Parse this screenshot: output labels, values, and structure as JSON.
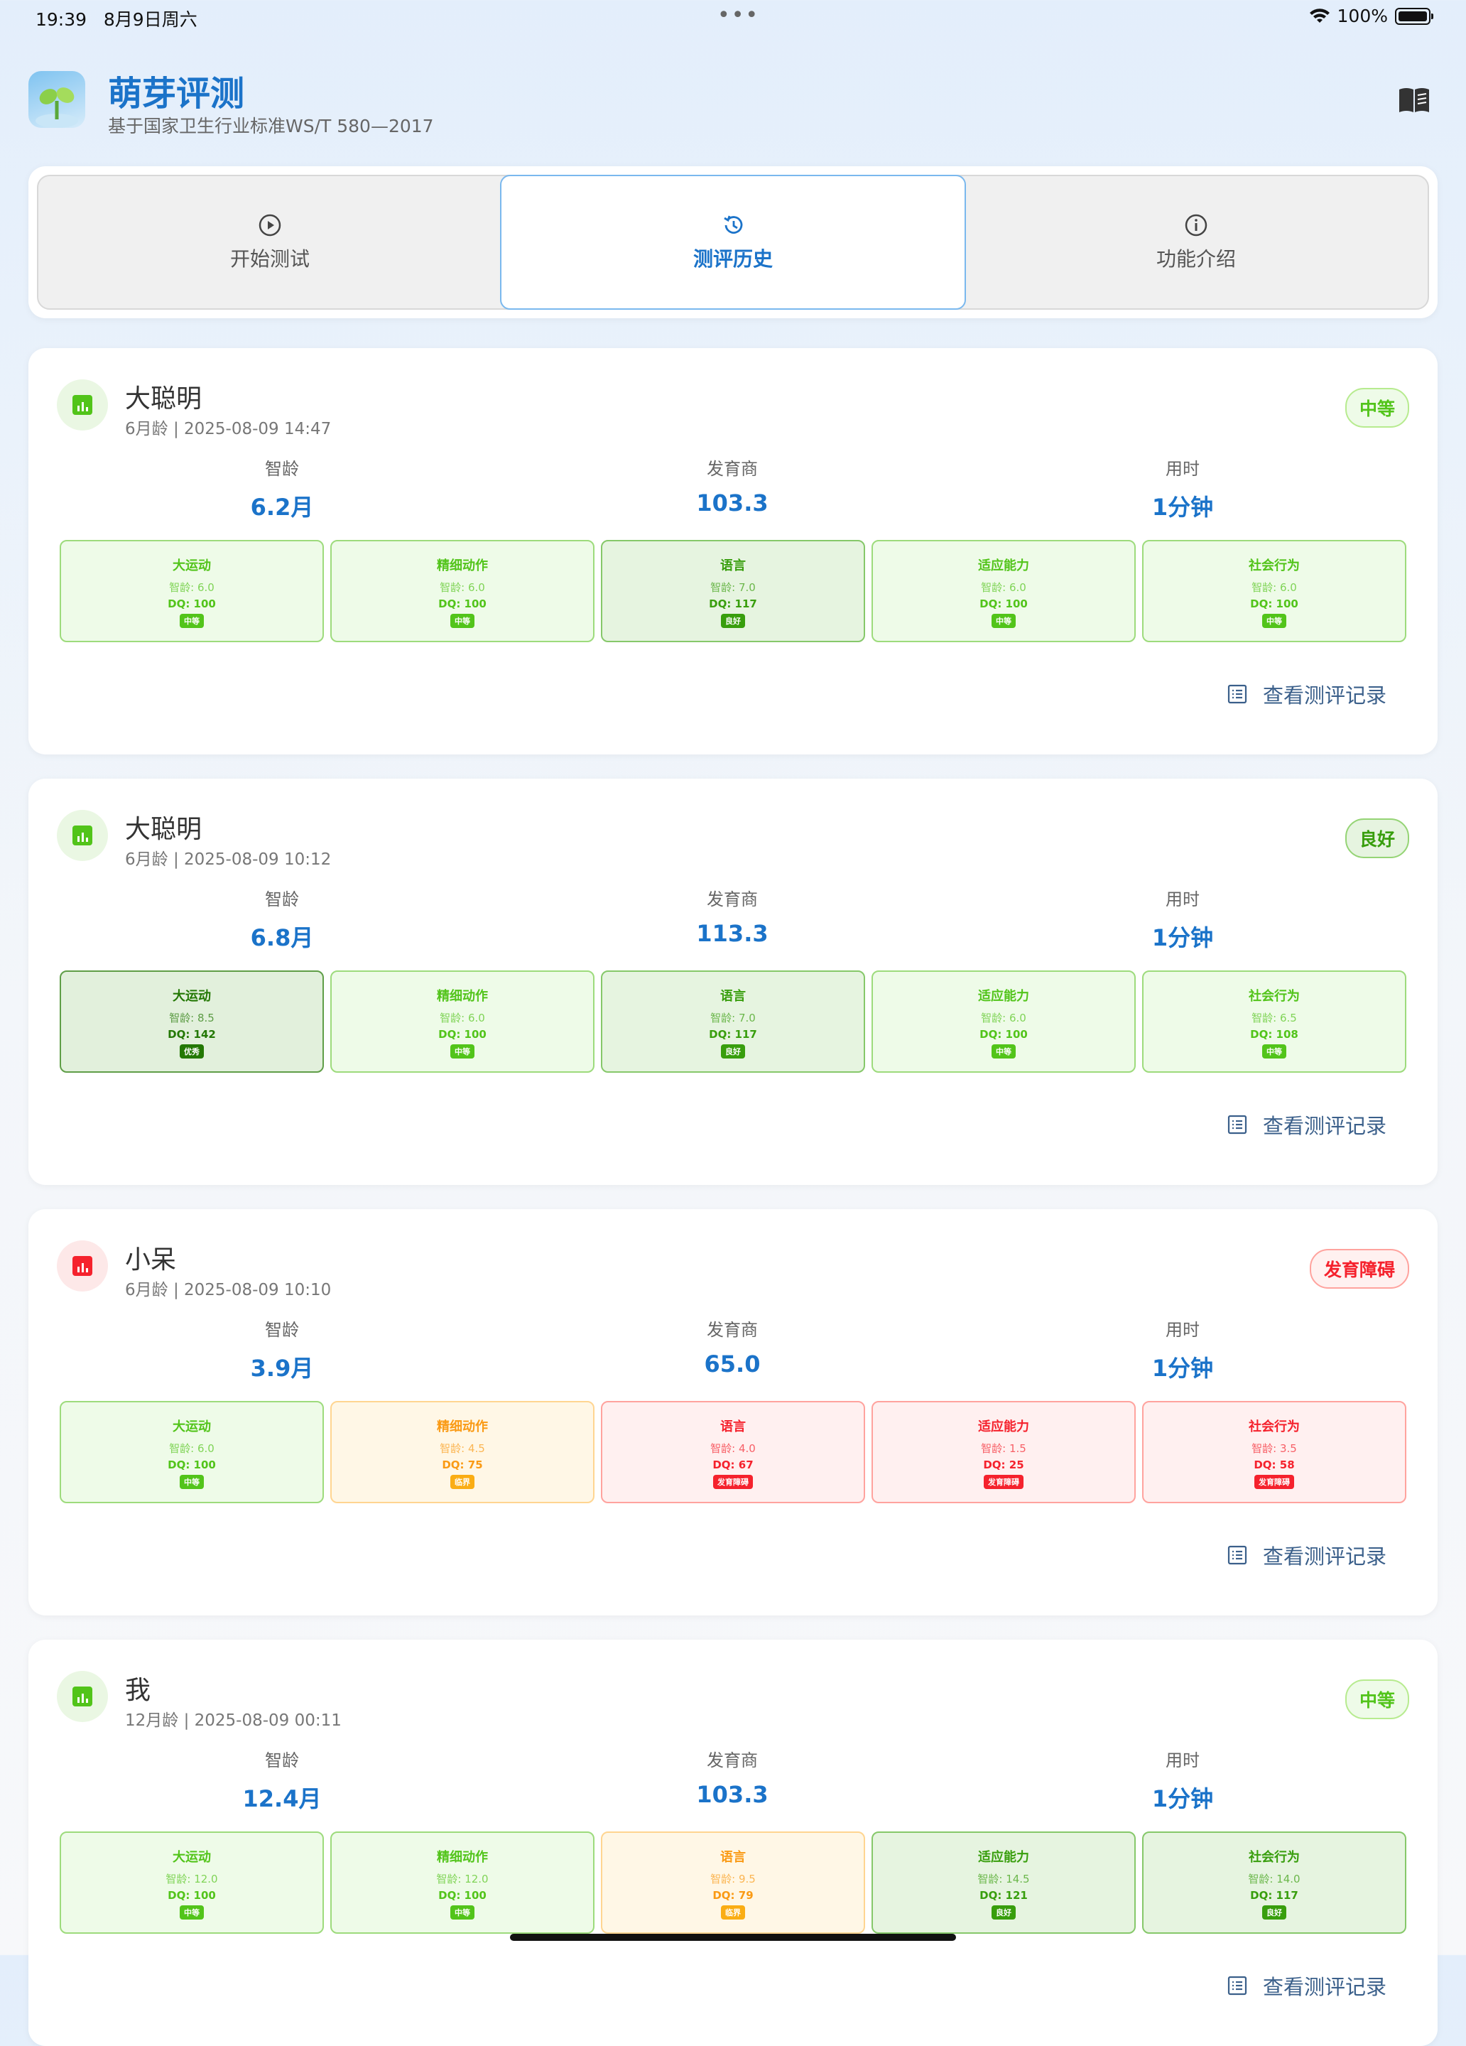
{
  "status_bar": {
    "time": "19:39",
    "date": "8月9日周六",
    "battery": "100%"
  },
  "app": {
    "title": "萌芽评测",
    "subtitle": "基于国家卫生行业标准WS/T 580—2017"
  },
  "tabs": [
    {
      "label": "开始测试",
      "icon": "play-circle-icon"
    },
    {
      "label": "测评历史",
      "icon": "history-icon"
    },
    {
      "label": "功能介绍",
      "icon": "info-icon"
    }
  ],
  "stat_labels": {
    "mental_age": "智龄",
    "dq": "发育商",
    "duration": "用时"
  },
  "view_record_label": "查看测评记录",
  "colors": {
    "中等": "#52c41a",
    "良好": "#389e0d",
    "优秀": "#237804",
    "临界": "#faad14",
    "发育障碍": "#f5222d"
  },
  "records": [
    {
      "name": "大聪明",
      "meta": "6月龄 | 2025-08-09 14:47",
      "level": "中等",
      "mental_age": "6.2月",
      "dq": "103.3",
      "duration": "1分钟",
      "domains": [
        {
          "name": "大运动",
          "age": "智龄: 6.0",
          "dq": "DQ: 100",
          "tag": "中等"
        },
        {
          "name": "精细动作",
          "age": "智龄: 6.0",
          "dq": "DQ: 100",
          "tag": "中等"
        },
        {
          "name": "语言",
          "age": "智龄: 7.0",
          "dq": "DQ: 117",
          "tag": "良好"
        },
        {
          "name": "适应能力",
          "age": "智龄: 6.0",
          "dq": "DQ: 100",
          "tag": "中等"
        },
        {
          "name": "社会行为",
          "age": "智龄: 6.0",
          "dq": "DQ: 100",
          "tag": "中等"
        }
      ]
    },
    {
      "name": "大聪明",
      "meta": "6月龄 | 2025-08-09 10:12",
      "level": "良好",
      "mental_age": "6.8月",
      "dq": "113.3",
      "duration": "1分钟",
      "domains": [
        {
          "name": "大运动",
          "age": "智龄: 8.5",
          "dq": "DQ: 142",
          "tag": "优秀"
        },
        {
          "name": "精细动作",
          "age": "智龄: 6.0",
          "dq": "DQ: 100",
          "tag": "中等"
        },
        {
          "name": "语言",
          "age": "智龄: 7.0",
          "dq": "DQ: 117",
          "tag": "良好"
        },
        {
          "name": "适应能力",
          "age": "智龄: 6.0",
          "dq": "DQ: 100",
          "tag": "中等"
        },
        {
          "name": "社会行为",
          "age": "智龄: 6.5",
          "dq": "DQ: 108",
          "tag": "中等"
        }
      ]
    },
    {
      "name": "小呆",
      "meta": "6月龄 | 2025-08-09 10:10",
      "level": "发育障碍",
      "mental_age": "3.9月",
      "dq": "65.0",
      "duration": "1分钟",
      "domains": [
        {
          "name": "大运动",
          "age": "智龄: 6.0",
          "dq": "DQ: 100",
          "tag": "中等"
        },
        {
          "name": "精细动作",
          "age": "智龄: 4.5",
          "dq": "DQ: 75",
          "tag": "临界"
        },
        {
          "name": "语言",
          "age": "智龄: 4.0",
          "dq": "DQ: 67",
          "tag": "发育障碍"
        },
        {
          "name": "适应能力",
          "age": "智龄: 1.5",
          "dq": "DQ: 25",
          "tag": "发育障碍"
        },
        {
          "name": "社会行为",
          "age": "智龄: 3.5",
          "dq": "DQ: 58",
          "tag": "发育障碍"
        }
      ]
    },
    {
      "name": "我",
      "meta": "12月龄 | 2025-08-09 00:11",
      "level": "中等",
      "mental_age": "12.4月",
      "dq": "103.3",
      "duration": "1分钟",
      "domains": [
        {
          "name": "大运动",
          "age": "智龄: 12.0",
          "dq": "DQ: 100",
          "tag": "中等"
        },
        {
          "name": "精细动作",
          "age": "智龄: 12.0",
          "dq": "DQ: 100",
          "tag": "中等"
        },
        {
          "name": "语言",
          "age": "智龄: 9.5",
          "dq": "DQ: 79",
          "tag": "临界"
        },
        {
          "name": "适应能力",
          "age": "智龄: 14.5",
          "dq": "DQ: 121",
          "tag": "良好"
        },
        {
          "name": "社会行为",
          "age": "智龄: 14.0",
          "dq": "DQ: 117",
          "tag": "良好"
        }
      ]
    }
  ]
}
